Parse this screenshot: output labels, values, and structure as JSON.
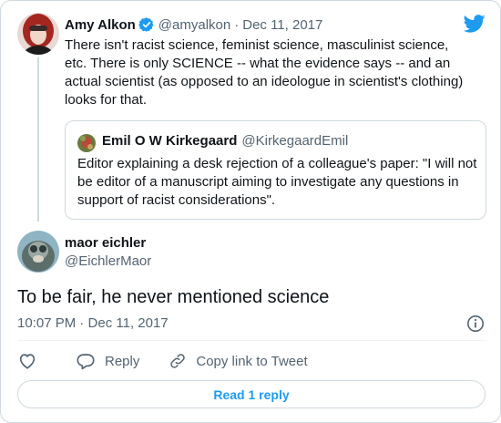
{
  "parent_tweet": {
    "author_name": "Amy Alkon",
    "handle": "@amyalkon",
    "separator": "·",
    "date": "Dec 11, 2017",
    "text": "There isn't racist science, feminist science, masculinist science, etc. There is only SCIENCE -- what the evidence says -- and an actual scientist (as opposed to an ideologue in scientist's clothing) looks for that.",
    "verified": true
  },
  "quoted_tweet": {
    "author_name": "Emil O W Kirkegaard",
    "handle": "@KirkegaardEmil",
    "text": "Editor explaining a desk rejection of a colleague's paper: \"I will not be editor of a manuscript aiming to investigate any questions in support of racist considerations\"."
  },
  "main_tweet": {
    "author_name": "maor eichler",
    "handle": "@EichlerMaor",
    "text": "To be fair, he never mentioned science",
    "timestamp": "10:07 PM · Dec 11, 2017"
  },
  "actions": {
    "reply_label": "Reply",
    "copy_label": "Copy link to Tweet"
  },
  "read_replies_label": "Read 1 reply",
  "icons": {
    "brand": "twitter-bird-icon",
    "verified": "verified-badge-icon",
    "info": "info-icon",
    "like": "heart-icon",
    "reply": "speech-bubble-icon",
    "copy": "link-icon"
  },
  "colors": {
    "accent": "#1d9bf0",
    "secondary_text": "#536471",
    "border": "#cfd9de"
  }
}
